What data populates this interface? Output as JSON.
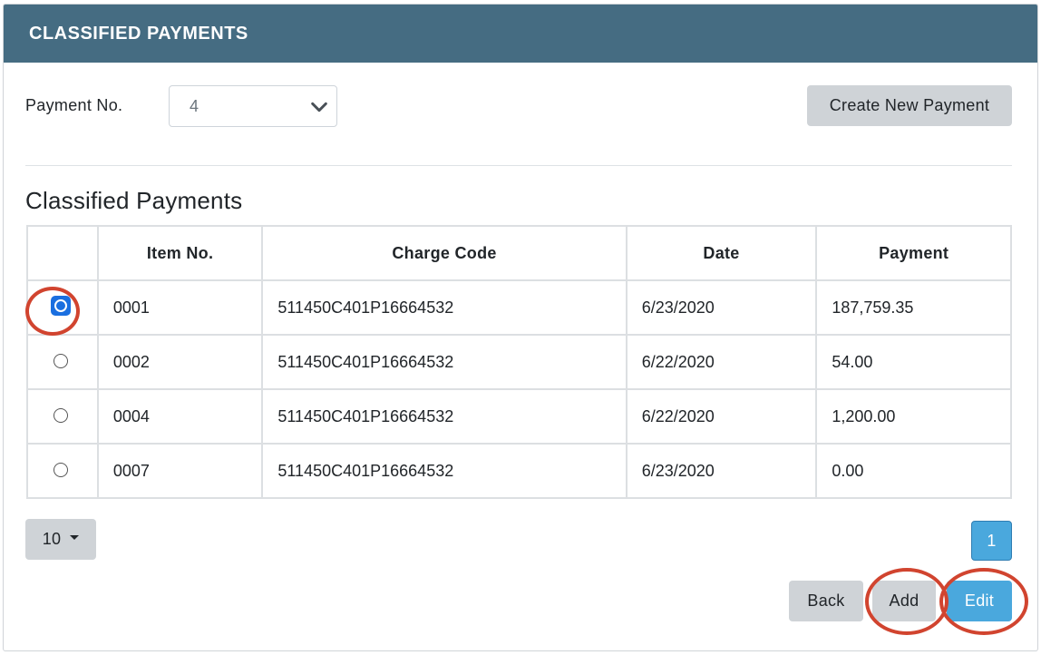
{
  "panel": {
    "title": "CLASSIFIED PAYMENTS"
  },
  "payment_no": {
    "label": "Payment No.",
    "selected": "4"
  },
  "create_button": "Create New Payment",
  "section_title": "Classified Payments",
  "table": {
    "headers": [
      "",
      "Item No.",
      "Charge Code",
      "Date",
      "Payment"
    ],
    "rows": [
      {
        "selected": true,
        "item_no": "0001",
        "charge_code": "511450C401P16664532",
        "date": "6/23/2020",
        "payment": "187,759.35"
      },
      {
        "selected": false,
        "item_no": "0002",
        "charge_code": "511450C401P16664532",
        "date": "6/22/2020",
        "payment": "54.00"
      },
      {
        "selected": false,
        "item_no": "0004",
        "charge_code": "511450C401P16664532",
        "date": "6/22/2020",
        "payment": "1,200.00"
      },
      {
        "selected": false,
        "item_no": "0007",
        "charge_code": "511450C401P16664532",
        "date": "6/23/2020",
        "payment": "0.00"
      }
    ]
  },
  "pagination": {
    "page_size": "10",
    "current_page": "1"
  },
  "actions": {
    "back": "Back",
    "add": "Add",
    "edit": "Edit"
  },
  "colors": {
    "header_bg": "#456c82",
    "primary_button": "#4aa8dd",
    "secondary_button": "#cfd3d7",
    "annotation_circle": "#d1442f",
    "selected_radio": "#1a6fe0"
  }
}
